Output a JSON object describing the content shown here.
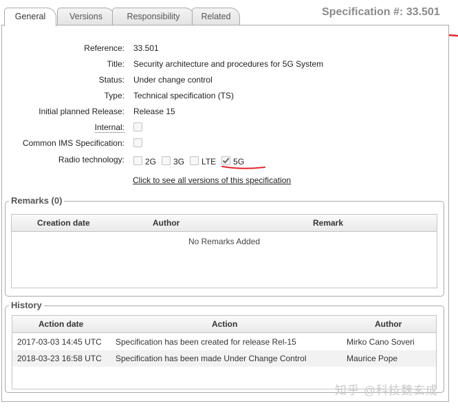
{
  "tabs": [
    "General",
    "Versions",
    "Responsibility",
    "Related"
  ],
  "spec_heading": "Specification #: 33.501",
  "fields": {
    "reference_label": "Reference:",
    "reference": "33.501",
    "title_label": "Title:",
    "title": "Security architecture and procedures for 5G System",
    "status_label": "Status:",
    "status": "Under change control",
    "type_label": "Type:",
    "type": "Technical specification (TS)",
    "release_label": "Initial planned Release:",
    "release": "Release 15",
    "internal_label": "Internal:",
    "internal_checked": false,
    "common_ims_label": "Common IMS Specification:",
    "common_ims_checked": false,
    "radio_label": "Radio technology:",
    "radio": [
      {
        "label": "2G",
        "checked": false
      },
      {
        "label": "3G",
        "checked": false
      },
      {
        "label": "LTE",
        "checked": false
      },
      {
        "label": "5G",
        "checked": true
      }
    ]
  },
  "versions_link": "Click to see all versions of this specification",
  "remarks": {
    "legend": "Remarks (0)",
    "headers": [
      "Creation date",
      "Author",
      "Remark"
    ],
    "empty_text": "No Remarks Added"
  },
  "history": {
    "legend": "History",
    "headers": [
      "Action date",
      "Action",
      "Author"
    ],
    "rows": [
      {
        "date": "2017-03-03 14:45 UTC",
        "action": "Specification has been created for release Rel-15",
        "author": "Mirko Cano Soveri"
      },
      {
        "date": "2018-03-23 16:58 UTC",
        "action": "Specification has been made Under Change Control",
        "author": "Maurice Pope"
      }
    ]
  },
  "watermark": "知乎 @科技魏玄成",
  "colors": {
    "annotation_red": "#e0262c",
    "border": "#a9a9a9"
  }
}
